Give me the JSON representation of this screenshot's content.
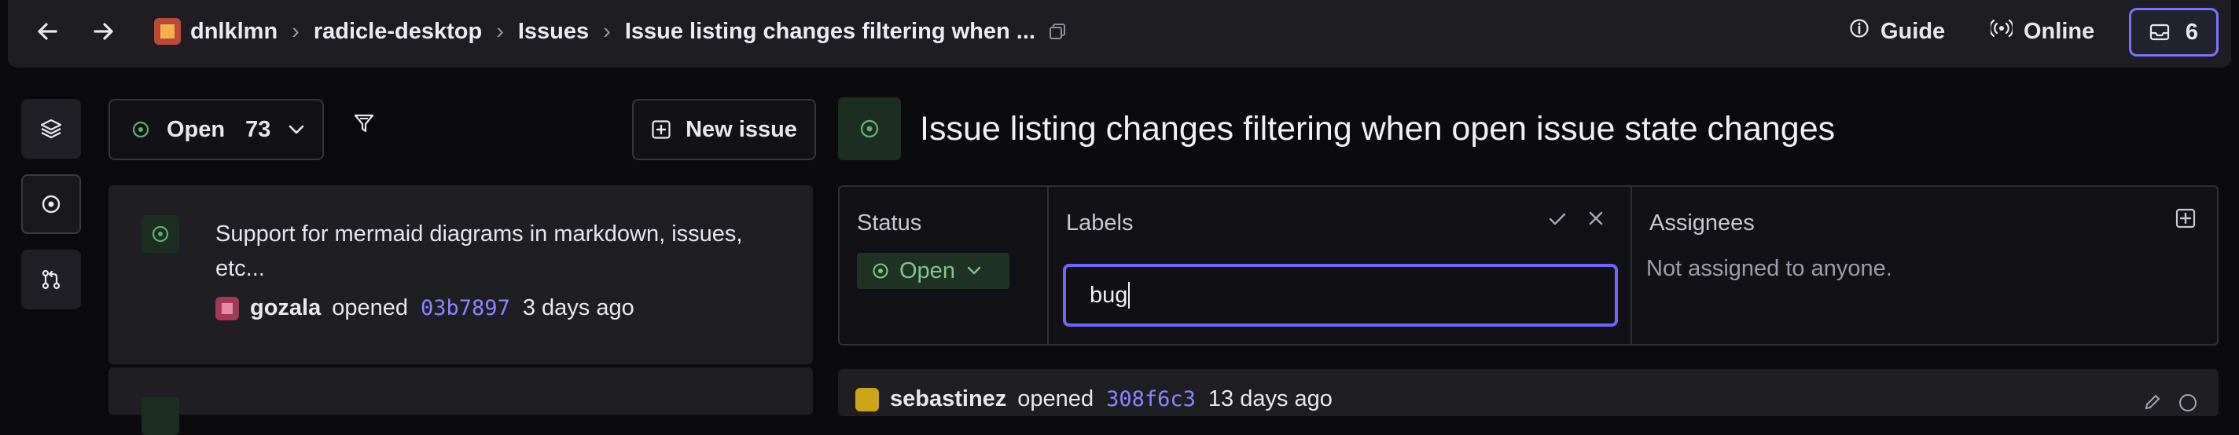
{
  "header": {
    "breadcrumb": [
      "dnlklmn",
      "radicle-desktop",
      "Issues",
      "Issue listing changes filtering when ..."
    ],
    "guide_label": "Guide",
    "online_label": "Online",
    "inbox_count": "6"
  },
  "list": {
    "filter_state": "Open",
    "filter_count": "73",
    "new_issue_label": "New issue",
    "issues": [
      {
        "title": "Support for mermaid diagrams in markdown, issues, etc...",
        "author": "gozala",
        "action": "opened",
        "commit": "03b7897",
        "time": "3 days ago"
      }
    ]
  },
  "detail": {
    "title": "Issue listing changes filtering when open issue state changes",
    "status_label": "Status",
    "status_value": "Open",
    "labels_label": "Labels",
    "labels_input_value": "bug",
    "assignees_label": "Assignees",
    "assignees_empty": "Not assigned to anyone.",
    "comment": {
      "author": "sebastinez",
      "action": "opened",
      "commit": "308f6c3",
      "time": "13 days ago"
    }
  },
  "colors": {
    "accent": "#7a73ff",
    "open_green": "#7dc68e",
    "link": "#8b85ff"
  }
}
